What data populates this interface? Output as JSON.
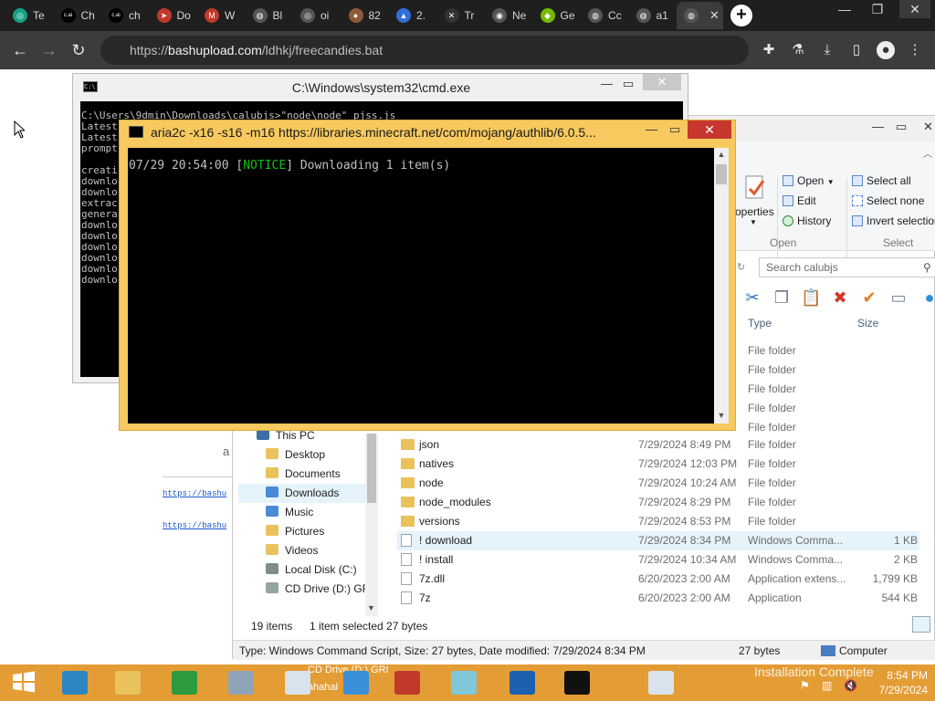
{
  "browser": {
    "tabs": [
      {
        "label": "Te",
        "icon": "openai-icon",
        "color": "#16a085",
        "glyph": "◎"
      },
      {
        "label": "Ch",
        "icon": "character-ai-icon",
        "color": "#000000",
        "glyph": "c.ai"
      },
      {
        "label": "ch",
        "icon": "character-ai-icon",
        "color": "#000000",
        "glyph": "c.ai"
      },
      {
        "label": "Do",
        "icon": "red-arrow-icon",
        "color": "#c0392b",
        "glyph": "➤"
      },
      {
        "label": "W",
        "icon": "gmail-icon",
        "color": "#c0392b",
        "glyph": "M"
      },
      {
        "label": "Bl",
        "icon": "globe-icon",
        "color": "#555555",
        "glyph": "◍"
      },
      {
        "label": "oi",
        "icon": "openai-icon",
        "color": "#555555",
        "glyph": "◎"
      },
      {
        "label": "82",
        "icon": "avatar-icon",
        "color": "#8e5b3a",
        "glyph": "●"
      },
      {
        "label": "2.",
        "icon": "cloud-icon",
        "color": "#2f6fd6",
        "glyph": "▲"
      },
      {
        "label": "Tr",
        "icon": "x-icon",
        "color": "#333333",
        "glyph": "✕"
      },
      {
        "label": "Ne",
        "icon": "chrome-icon",
        "color": "#555555",
        "glyph": "◉"
      },
      {
        "label": "Ge",
        "icon": "nvidia-icon",
        "color": "#76b900",
        "glyph": "◆"
      },
      {
        "label": "Cc",
        "icon": "globe-icon",
        "color": "#555555",
        "glyph": "◍"
      },
      {
        "label": "a1",
        "icon": "globe-icon",
        "color": "#555555",
        "glyph": "◍"
      },
      {
        "label": "",
        "icon": "globe-icon",
        "color": "#555555",
        "glyph": "◍"
      }
    ],
    "active_tab_close": "✕",
    "new_tab": "+",
    "url_scheme": "https://",
    "url_host": "bashupload.com",
    "url_path": "/ldhkj/freecandies.bat"
  },
  "page": {
    "link1": "https://bashu",
    "link2": "https://bashu",
    "stray_text": "a"
  },
  "cmd": {
    "title": "C:\\Windows\\system32\\cmd.exe",
    "icon_glyph": "C:\\",
    "lines": [
      "C:\\Users\\9dmin\\Downloads\\calubjs>\"node\\node\" pjss.js",
      "Latest",
      "Latest",
      "prompt",
      "",
      "creati",
      "downlo",
      "downlo",
      "extrac",
      "genera",
      "downlo",
      "downlo",
      "downlo",
      "downlo",
      "downlo",
      "downlo"
    ]
  },
  "aria": {
    "title": "aria2c  -x16 -s16 -m16 https://libraries.minecraft.net/com/mojang/authlib/6.0.5...",
    "line_time": "07/29 20:54:00 [",
    "line_notice": "NOTICE",
    "line_rest": "] Downloading 1 item(s)"
  },
  "explorer": {
    "ribbon": {
      "properties": "operties",
      "open": "Open",
      "edit": "Edit",
      "history": "History",
      "group_open": "Open",
      "select_all": "Select all",
      "select_none": "Select none",
      "invert_selection": "Invert selection",
      "group_select": "Select"
    },
    "search_placeholder": "Search calubjs",
    "columns": {
      "type": "Type",
      "size": "Size"
    },
    "type_only_rows": [
      "File folder",
      "File folder",
      "File folder",
      "File folder",
      "File folder"
    ],
    "nav": [
      {
        "label": "This PC",
        "color": "#3a6ea5"
      },
      {
        "label": "Desktop",
        "color": "#e9c25c"
      },
      {
        "label": "Documents",
        "color": "#e9c25c"
      },
      {
        "label": "Downloads",
        "color": "#4a8ad6"
      },
      {
        "label": "Music",
        "color": "#4a8ad6"
      },
      {
        "label": "Pictures",
        "color": "#e9c25c"
      },
      {
        "label": "Videos",
        "color": "#e9c25c"
      },
      {
        "label": "Local Disk (C:)",
        "color": "#7f8c8d"
      },
      {
        "label": "CD Drive (D:) GRI",
        "color": "#95a5a6"
      }
    ],
    "files": [
      {
        "name": "json",
        "date": "7/29/2024 8:49 PM",
        "type": "File folder",
        "size": "",
        "kind": "folder"
      },
      {
        "name": "natives",
        "date": "7/29/2024 12:03 PM",
        "type": "File folder",
        "size": "",
        "kind": "folder"
      },
      {
        "name": "node",
        "date": "7/29/2024 10:24 AM",
        "type": "File folder",
        "size": "",
        "kind": "folder"
      },
      {
        "name": "node_modules",
        "date": "7/29/2024 8:29 PM",
        "type": "File folder",
        "size": "",
        "kind": "folder"
      },
      {
        "name": "versions",
        "date": "7/29/2024 8:53 PM",
        "type": "File folder",
        "size": "",
        "kind": "folder"
      },
      {
        "name": "! download",
        "date": "7/29/2024 8:34 PM",
        "type": "Windows Comma...",
        "size": "1 KB",
        "kind": "file"
      },
      {
        "name": "! install",
        "date": "7/29/2024 10:34 AM",
        "type": "Windows Comma...",
        "size": "2 KB",
        "kind": "file"
      },
      {
        "name": "7z.dll",
        "date": "6/20/2023 2:00 AM",
        "type": "Application extens...",
        "size": "1,799 KB",
        "kind": "file"
      },
      {
        "name": "7z",
        "date": "6/20/2023 2:00 AM",
        "type": "Application",
        "size": "544 KB",
        "kind": "file"
      }
    ],
    "status_items": "19 items",
    "status_selected": "1 item selected  27 bytes",
    "details": "Type: Windows Command Script, Size: 27 bytes, Date modified: 7/29/2024 8:34 PM",
    "details_size": "27 bytes",
    "details_location": "Computer"
  },
  "taskbar": {
    "apps": [
      {
        "name": "start-button",
        "color": "#1e73be"
      },
      {
        "name": "internet-explorer-icon",
        "color": "#2e86c1"
      },
      {
        "name": "file-explorer-icon",
        "color": "#e9c25c"
      },
      {
        "name": "store-icon",
        "color": "#2e9c3e"
      },
      {
        "name": "resource-monitor-icon",
        "color": "#8fa3b7"
      },
      {
        "name": "app-window-icon",
        "color": "#d9e3ee"
      },
      {
        "name": "disc-icon",
        "color": "#3b8fd6"
      },
      {
        "name": "red-arrow-icon",
        "color": "#c0392b"
      },
      {
        "name": "notes-icon",
        "color": "#7fc7d9"
      },
      {
        "name": "defender-icon",
        "color": "#1e60b0"
      },
      {
        "name": "cmd-icon",
        "color": "#111111"
      },
      {
        "name": "window-icon",
        "color": "#d9e3ee"
      }
    ],
    "cd_drive_label": "CD Drive (D:) GRI",
    "sub_label": "ahahal",
    "install_status": "Installation Complete",
    "time": "8:54 PM",
    "date": "7/29/2024"
  }
}
